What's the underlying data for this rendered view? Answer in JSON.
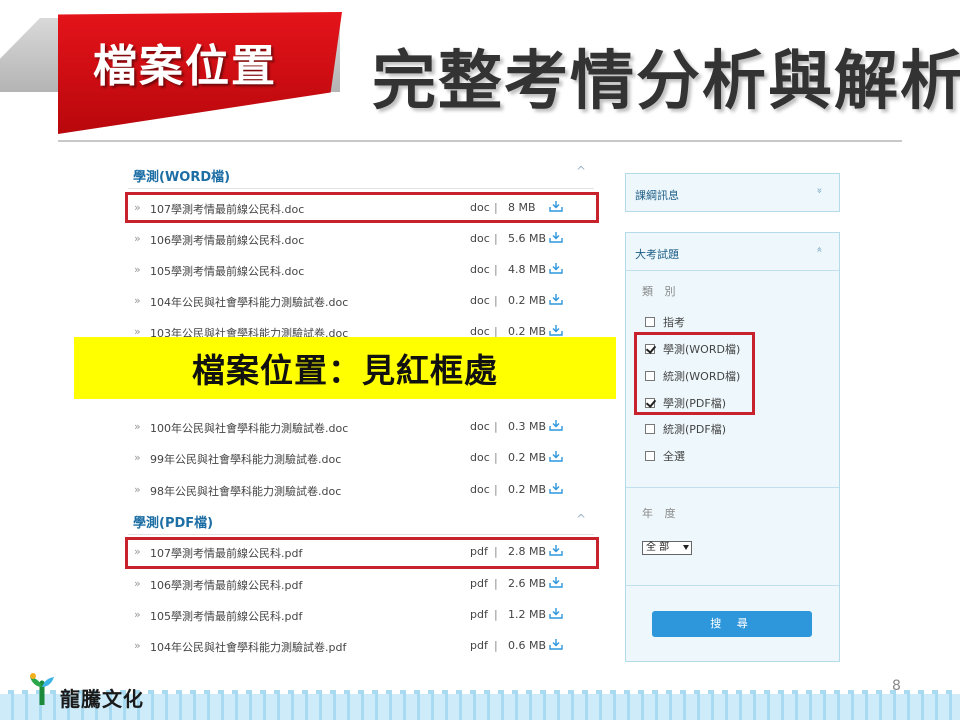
{
  "header": {
    "tag_text": "檔案位置",
    "title": "完整考情分析與解析"
  },
  "banner": {
    "text": "檔案位置：見紅框處"
  },
  "sections": [
    {
      "title": "學測(WORD檔)",
      "chevron": "^",
      "files": [
        {
          "name": "107學測考情最前線公民科.doc",
          "type": "doc",
          "size": "8 MB",
          "highlighted": true
        },
        {
          "name": "106學測考情最前線公民科.doc",
          "type": "doc",
          "size": "5.6 MB"
        },
        {
          "name": "105學測考情最前線公民科.doc",
          "type": "doc",
          "size": "4.8 MB"
        },
        {
          "name": "104年公民與社會學科能力測驗試卷.doc",
          "type": "doc",
          "size": "0.2 MB"
        },
        {
          "name": "103年公民與社會學科能力測驗試卷.doc",
          "type": "doc",
          "size": "0.2 MB"
        },
        {
          "name": "100年公民與社會學科能力測驗試卷.doc",
          "type": "doc",
          "size": "0.3 MB"
        },
        {
          "name": "99年公民與社會學科能力測驗試卷.doc",
          "type": "doc",
          "size": "0.2 MB"
        },
        {
          "name": "98年公民與社會學科能力測驗試卷.doc",
          "type": "doc",
          "size": "0.2 MB"
        }
      ]
    },
    {
      "title": "學測(PDF檔)",
      "chevron": "^",
      "files": [
        {
          "name": "107學測考情最前線公民科.pdf",
          "type": "pdf",
          "size": "2.8 MB",
          "highlighted": true
        },
        {
          "name": "106學測考情最前線公民科.pdf",
          "type": "pdf",
          "size": "2.6 MB"
        },
        {
          "name": "105學測考情最前線公民科.pdf",
          "type": "pdf",
          "size": "1.2 MB"
        },
        {
          "name": "104年公民與社會學科能力測驗試卷.pdf",
          "type": "pdf",
          "size": "0.6 MB"
        }
      ]
    }
  ],
  "separator": "|",
  "bullet": "»",
  "sidebar": {
    "curriculum": {
      "title": "課綱訊息",
      "chevron": "»"
    },
    "exams": {
      "title": "大考試題",
      "chevron": "«",
      "category_label": "類 別",
      "checkboxes": [
        {
          "label": "指考",
          "checked": false
        },
        {
          "label": "學測(WORD檔)",
          "checked": true
        },
        {
          "label": "統測(WORD檔)",
          "checked": false
        },
        {
          "label": "學測(PDF檔)",
          "checked": true
        },
        {
          "label": "統測(PDF檔)",
          "checked": false
        },
        {
          "label": "全選",
          "checked": false
        }
      ],
      "year_label": "年 度",
      "year_select": "全 部",
      "search_button": "搜 尋"
    }
  },
  "footer": {
    "logo_text": "龍騰文化",
    "page_number": "8"
  },
  "colors": {
    "accent_blue": "#1c6ea4",
    "highlight_red": "#c8232c",
    "banner_yellow": "#ffff00",
    "button_blue": "#2e97dc"
  }
}
